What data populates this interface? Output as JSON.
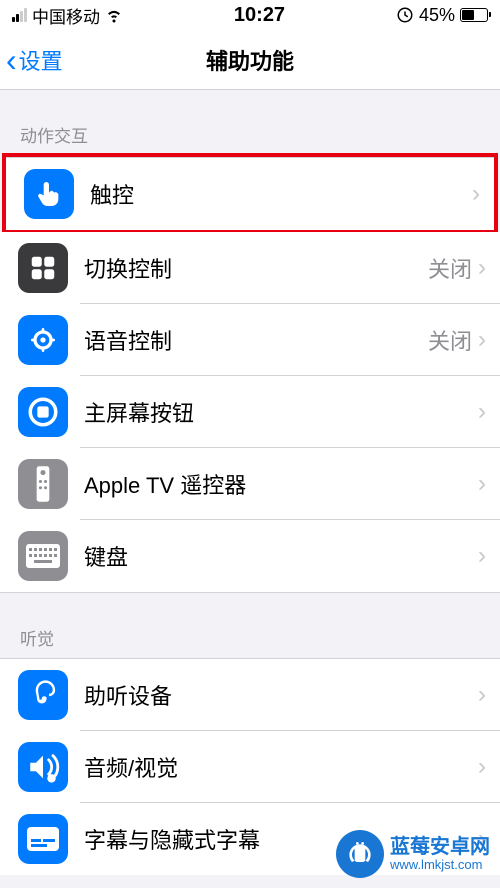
{
  "status": {
    "carrier": "中国移动",
    "time": "10:27",
    "battery_pct": "45%",
    "battery_fill_pct": 45
  },
  "nav": {
    "back_label": "设置",
    "title": "辅助功能"
  },
  "sections": {
    "motor": {
      "header": "动作交互",
      "items": {
        "touch": {
          "label": "触控"
        },
        "switch_control": {
          "label": "切换控制",
          "value": "关闭"
        },
        "voice_control": {
          "label": "语音控制",
          "value": "关闭"
        },
        "home_button": {
          "label": "主屏幕按钮"
        },
        "apple_tv_remote": {
          "label": "Apple TV 遥控器"
        },
        "keyboard": {
          "label": "键盘"
        }
      }
    },
    "hearing": {
      "header": "听觉",
      "items": {
        "hearing_devices": {
          "label": "助听设备"
        },
        "audio_visual": {
          "label": "音频/视觉"
        },
        "subtitles": {
          "label": "字幕与隐藏式字幕"
        }
      }
    }
  },
  "watermark": {
    "title": "蓝莓安卓网",
    "url": "www.lmkjst.com"
  }
}
